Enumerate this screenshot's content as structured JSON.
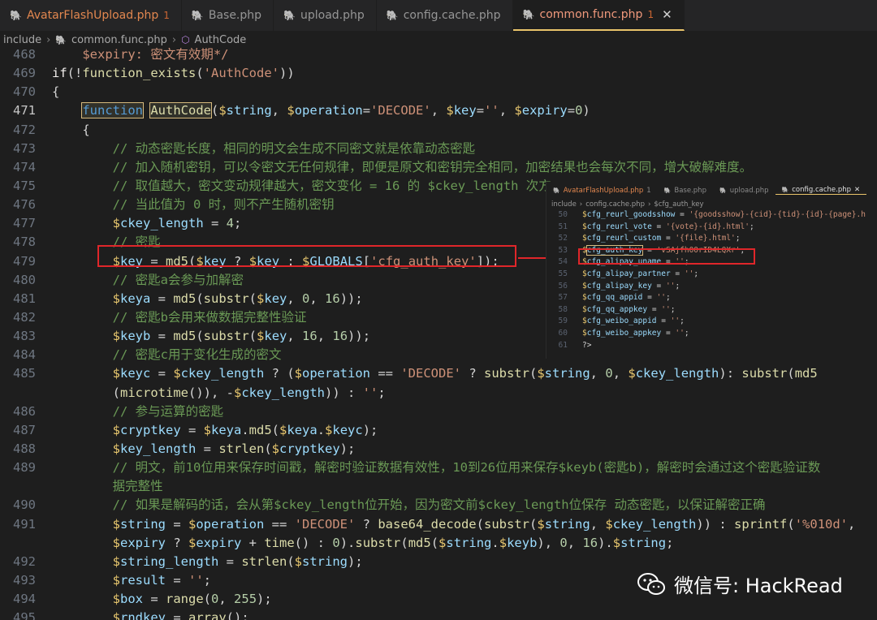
{
  "tabs": [
    {
      "name": "AvatarFlashUpload.php",
      "count": "1",
      "modified": true,
      "active": false
    },
    {
      "name": "Base.php",
      "count": "",
      "modified": false,
      "active": false
    },
    {
      "name": "upload.php",
      "count": "",
      "modified": false,
      "active": false
    },
    {
      "name": "config.cache.php",
      "count": "",
      "modified": false,
      "active": false
    },
    {
      "name": "common.func.php",
      "count": "1",
      "modified": true,
      "active": true
    }
  ],
  "tab_close_glyph": "✕",
  "breadcrumb": {
    "folder": "include",
    "file": "common.func.php",
    "symbol": "AuthCode"
  },
  "code_lines": [
    {
      "ln": "468",
      "html": "<span class='str'>    $expiry: 密文有效期*/</span>"
    },
    {
      "ln": "469",
      "html": "<span class='kw'>if</span>(!<span class='fn'>function_exists</span>(<span class='str'>'AuthCode'</span>))"
    },
    {
      "ln": "470",
      "html": "{"
    },
    {
      "ln": "471",
      "html": "    <span class='fnk hl'>function</span> <span class='fn hl'>AuthCode</span>(<span class='var'>$</span><span class='vn'>string</span>, <span class='var'>$</span><span class='vn'>operation</span>=<span class='str'>'DECODE'</span>, <span class='var'>$</span><span class='vn'>key</span>=<span class='str'>''</span>, <span class='var'>$</span><span class='vn'>expiry</span>=<span class='num'>0</span>)",
      "cur": true
    },
    {
      "ln": "472",
      "html": "    {"
    },
    {
      "ln": "473",
      "html": "        <span class='cm'>// 动态密匙长度，相同的明文会生成不同密文就是依靠动态密匙</span>"
    },
    {
      "ln": "474",
      "html": "        <span class='cm'>// 加入随机密钥，可以令密文无任何规律，即便是原文和密钥完全相同，加密结果也会每次不同，增大破解难度。</span>"
    },
    {
      "ln": "475",
      "html": "        <span class='cm'>// 取值越大，密文变动规律越大，密文变化 = 16 的 $ckey_length 次方</span>"
    },
    {
      "ln": "476",
      "html": "        <span class='cm'>// 当此值为 0 时，则不产生随机密钥</span>"
    },
    {
      "ln": "477",
      "html": "        <span class='var'>$</span><span class='vn'>ckey_length</span> = <span class='num'>4</span>;"
    },
    {
      "ln": "478",
      "html": "        <span class='cm'>// 密匙</span>"
    },
    {
      "ln": "479",
      "html": "        <span class='var'>$</span><span class='vn'>key</span> = <span class='fn'>md5</span>(<span class='var'>$</span><span class='vn'>key</span> ? <span class='var'>$</span><span class='vn'>key</span> : <span class='var'>$</span><span class='vn'>GLOBALS</span>[<span class='str'>'cfg_auth_key'</span>]);"
    },
    {
      "ln": "480",
      "html": "        <span class='cm'>// 密匙a会参与加解密</span>"
    },
    {
      "ln": "481",
      "html": "        <span class='var'>$</span><span class='vn'>keya</span> = <span class='fn'>md5</span>(<span class='fn'>substr</span>(<span class='var'>$</span><span class='vn'>key</span>, <span class='num'>0</span>, <span class='num'>16</span>));"
    },
    {
      "ln": "482",
      "html": "        <span class='cm'>// 密匙b会用来做数据完整性验证</span>"
    },
    {
      "ln": "483",
      "html": "        <span class='var'>$</span><span class='vn'>keyb</span> = <span class='fn'>md5</span>(<span class='fn'>substr</span>(<span class='var'>$</span><span class='vn'>key</span>, <span class='num'>16</span>, <span class='num'>16</span>));"
    },
    {
      "ln": "484",
      "html": "        <span class='cm'>// 密匙c用于变化生成的密文</span>"
    },
    {
      "ln": "485",
      "html": "        <span class='var'>$</span><span class='vn'>keyc</span> = <span class='var'>$</span><span class='vn'>ckey_length</span> ? (<span class='var'>$</span><span class='vn'>operation</span> == <span class='str'>'DECODE'</span> ? <span class='fn'>substr</span>(<span class='var'>$</span><span class='vn'>string</span>, <span class='num'>0</span>, <span class='var'>$</span><span class='vn'>ckey_length</span>): <span class='fn'>substr</span>(<span class='fn'>md5</span>"
    },
    {
      "ln": "",
      "html": "        (<span class='fn'>microtime</span>()), -<span class='var'>$</span><span class='vn'>ckey_length</span>)) : <span class='str'>''</span>;"
    },
    {
      "ln": "486",
      "html": "        <span class='cm'>// 参与运算的密匙</span>"
    },
    {
      "ln": "487",
      "html": "        <span class='var'>$</span><span class='vn'>cryptkey</span> = <span class='var'>$</span><span class='vn'>keya</span>.<span class='fn'>md5</span>(<span class='var'>$</span><span class='vn'>keya</span>.<span class='var'>$</span><span class='vn'>keyc</span>);"
    },
    {
      "ln": "488",
      "html": "        <span class='var'>$</span><span class='vn'>key_length</span> = <span class='fn'>strlen</span>(<span class='var'>$</span><span class='vn'>cryptkey</span>);"
    },
    {
      "ln": "489",
      "html": "        <span class='cm'>// 明文，前10位用来保存时间戳，解密时验证数据有效性，10到26位用来保存$keyb(密匙b)，解密时会通过这个密匙验证数</span>"
    },
    {
      "ln": "",
      "html": "        <span class='cm'>据完整性</span>"
    },
    {
      "ln": "490",
      "html": "        <span class='cm'>// 如果是解码的话，会从第$ckey_length位开始，因为密文前$ckey_length位保存 动态密匙，以保证解密正确</span>"
    },
    {
      "ln": "491",
      "html": "        <span class='var'>$</span><span class='vn'>string</span> = <span class='var'>$</span><span class='vn'>operation</span> == <span class='str'>'DECODE'</span> ? <span class='fn'>base64_decode</span>(<span class='fn'>substr</span>(<span class='var'>$</span><span class='vn'>string</span>, <span class='var'>$</span><span class='vn'>ckey_length</span>)) : <span class='fn'>sprintf</span>(<span class='str'>'%010d'</span>,"
    },
    {
      "ln": "",
      "html": "        <span class='var'>$</span><span class='vn'>expiry</span> ? <span class='var'>$</span><span class='vn'>expiry</span> + <span class='fn'>time</span>() : <span class='num'>0</span>).<span class='fn'>substr</span>(<span class='fn'>md5</span>(<span class='var'>$</span><span class='vn'>string</span>.<span class='var'>$</span><span class='vn'>keyb</span>), <span class='num'>0</span>, <span class='num'>16</span>).<span class='var'>$</span><span class='vn'>string</span>;"
    },
    {
      "ln": "492",
      "html": "        <span class='var'>$</span><span class='vn'>string_length</span> = <span class='fn'>strlen</span>(<span class='var'>$</span><span class='vn'>string</span>);"
    },
    {
      "ln": "493",
      "html": "        <span class='var'>$</span><span class='vn'>result</span> = <span class='str'>''</span>;"
    },
    {
      "ln": "494",
      "html": "        <span class='var'>$</span><span class='vn'>box</span> = <span class='fn'>range</span>(<span class='num'>0</span>, <span class='num'>255</span>);"
    },
    {
      "ln": "495",
      "html": "        <span class='var'>$</span><span class='vn'>rndkey</span> = <span class='fn'>array</span>();"
    }
  ],
  "inset": {
    "tabs": [
      {
        "name": "AvatarFlashUpload.php",
        "count": "1",
        "modified": true,
        "active": false
      },
      {
        "name": "Base.php",
        "count": "",
        "modified": false,
        "active": false
      },
      {
        "name": "upload.php",
        "count": "",
        "modified": false,
        "active": false
      },
      {
        "name": "config.cache.php",
        "count": "",
        "modified": false,
        "active": true
      }
    ],
    "breadcrumb": {
      "folder": "include",
      "file": "config.cache.php",
      "symbol": "$cfg_auth_key"
    },
    "lines": [
      {
        "ln": "50",
        "html": "<span class='var'>$</span><span class='vn'>cfg_reurl_goodsshow</span> = <span class='str'>'{goodsshow}-{cid}-{tid}-{id}-{page}.h</span>"
      },
      {
        "ln": "51",
        "html": "<span class='var'>$</span><span class='vn'>cfg_reurl_vote</span> = <span class='str'>'{vote}-{id}.html'</span>;"
      },
      {
        "ln": "52",
        "html": "<span class='var'>$</span><span class='vn'>cfg_reurl_custom</span> = <span class='str'>'{file}.html'</span>;"
      },
      {
        "ln": "53",
        "html": "<span class='var'>$</span><span class='vn' style='outline:1px solid #d7ba7d'>cfg_auth_key</span> = <span class='str'>'vSAjfh00rID4LQXr'</span>;"
      },
      {
        "ln": "54",
        "html": "<span class='var'>$</span><span class='vn'>cfg_alipay_uname</span> = <span class='str'>''</span>;"
      },
      {
        "ln": "55",
        "html": "<span class='var'>$</span><span class='vn'>cfg_alipay_partner</span> = <span class='str'>''</span>;"
      },
      {
        "ln": "56",
        "html": "<span class='var'>$</span><span class='vn'>cfg_alipay_key</span> = <span class='str'>''</span>;"
      },
      {
        "ln": "57",
        "html": "<span class='var'>$</span><span class='vn'>cfg_qq_appid</span> = <span class='str'>''</span>;"
      },
      {
        "ln": "58",
        "html": "<span class='var'>$</span><span class='vn'>cfg_qq_appkey</span> = <span class='str'>''</span>;"
      },
      {
        "ln": "59",
        "html": "<span class='var'>$</span><span class='vn'>cfg_weibo_appid</span> = <span class='str'>''</span>;"
      },
      {
        "ln": "60",
        "html": "<span class='var'>$</span><span class='vn'>cfg_weibo_appkey</span> = <span class='str'>''</span>;"
      },
      {
        "ln": "61",
        "html": "<span class='op'>?&gt;</span>"
      }
    ]
  },
  "watermark": {
    "text": "微信号: HackRead"
  },
  "colors": {
    "annotation_red": "#e0262a",
    "active_tab_border": "#e9c46a",
    "editor_bg": "#1e1e1e"
  }
}
